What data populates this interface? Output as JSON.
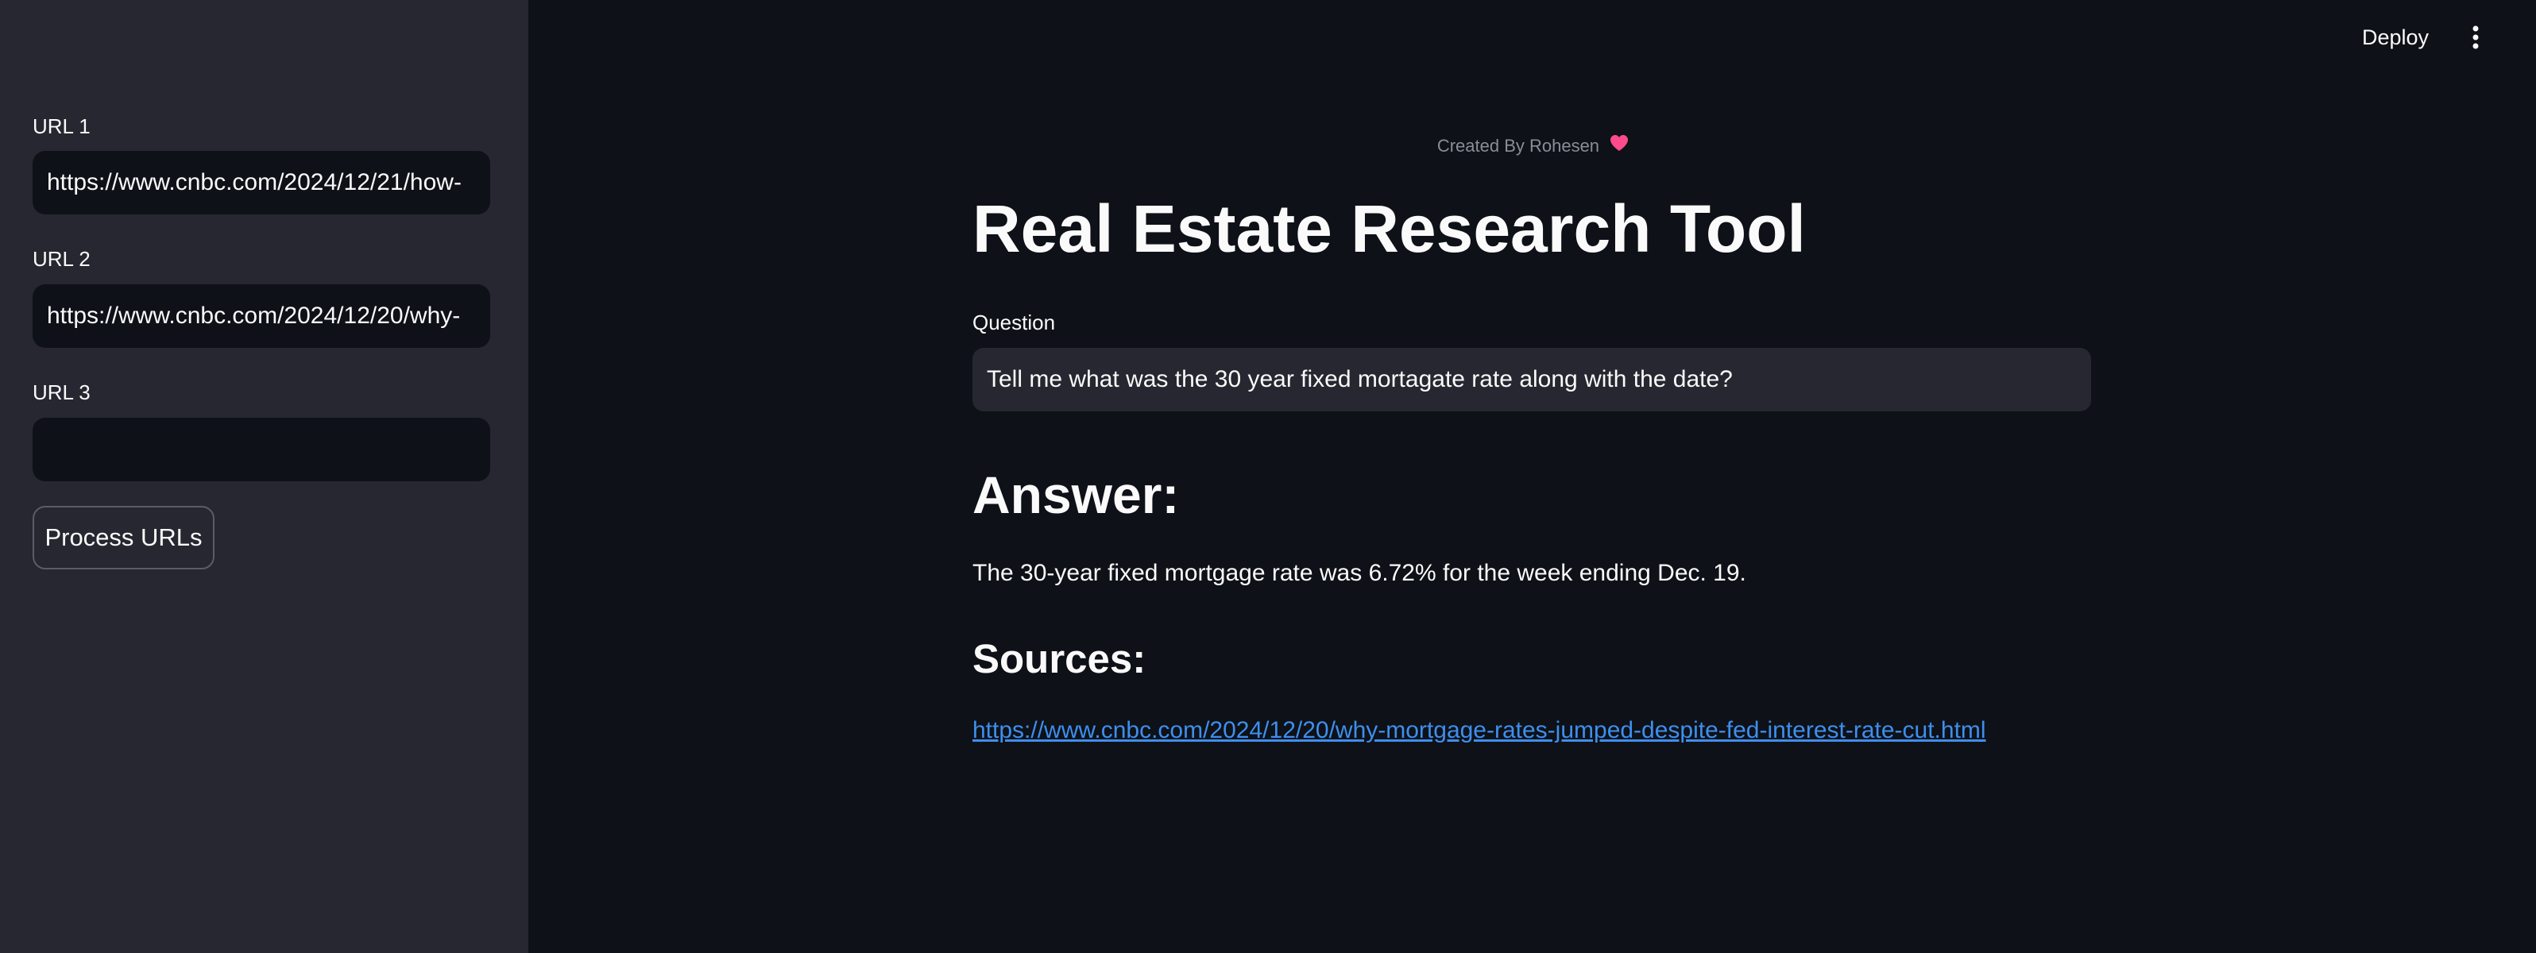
{
  "sidebar": {
    "url1_label": "URL 1",
    "url1_value": "https://www.cnbc.com/2024/12/21/how-",
    "url2_label": "URL 2",
    "url2_value": "https://www.cnbc.com/2024/12/20/why-",
    "url3_label": "URL 3",
    "url3_value": "",
    "process_button": "Process URLs"
  },
  "header": {
    "deploy_label": "Deploy",
    "menu_icon": "more-vertical-icon"
  },
  "main": {
    "credit": "Created By Rohesen",
    "credit_icon": "heart-icon",
    "title": "Real Estate Research Tool",
    "question_label": "Question",
    "question_value": "Tell me what was the 30 year fixed mortagate rate along with the date?",
    "answer_heading": "Answer:",
    "answer_text": "The 30-year fixed mortgage rate was 6.72% for the week ending Dec. 19.",
    "sources_heading": "Sources:",
    "source_link": "https://www.cnbc.com/2024/12/20/why-mortgage-rates-jumped-despite-fed-interest-rate-cut.html"
  },
  "colors": {
    "background": "#0e1117",
    "sidebar": "#262730",
    "link": "#3d8fee",
    "heart": "#ff4b8b"
  }
}
